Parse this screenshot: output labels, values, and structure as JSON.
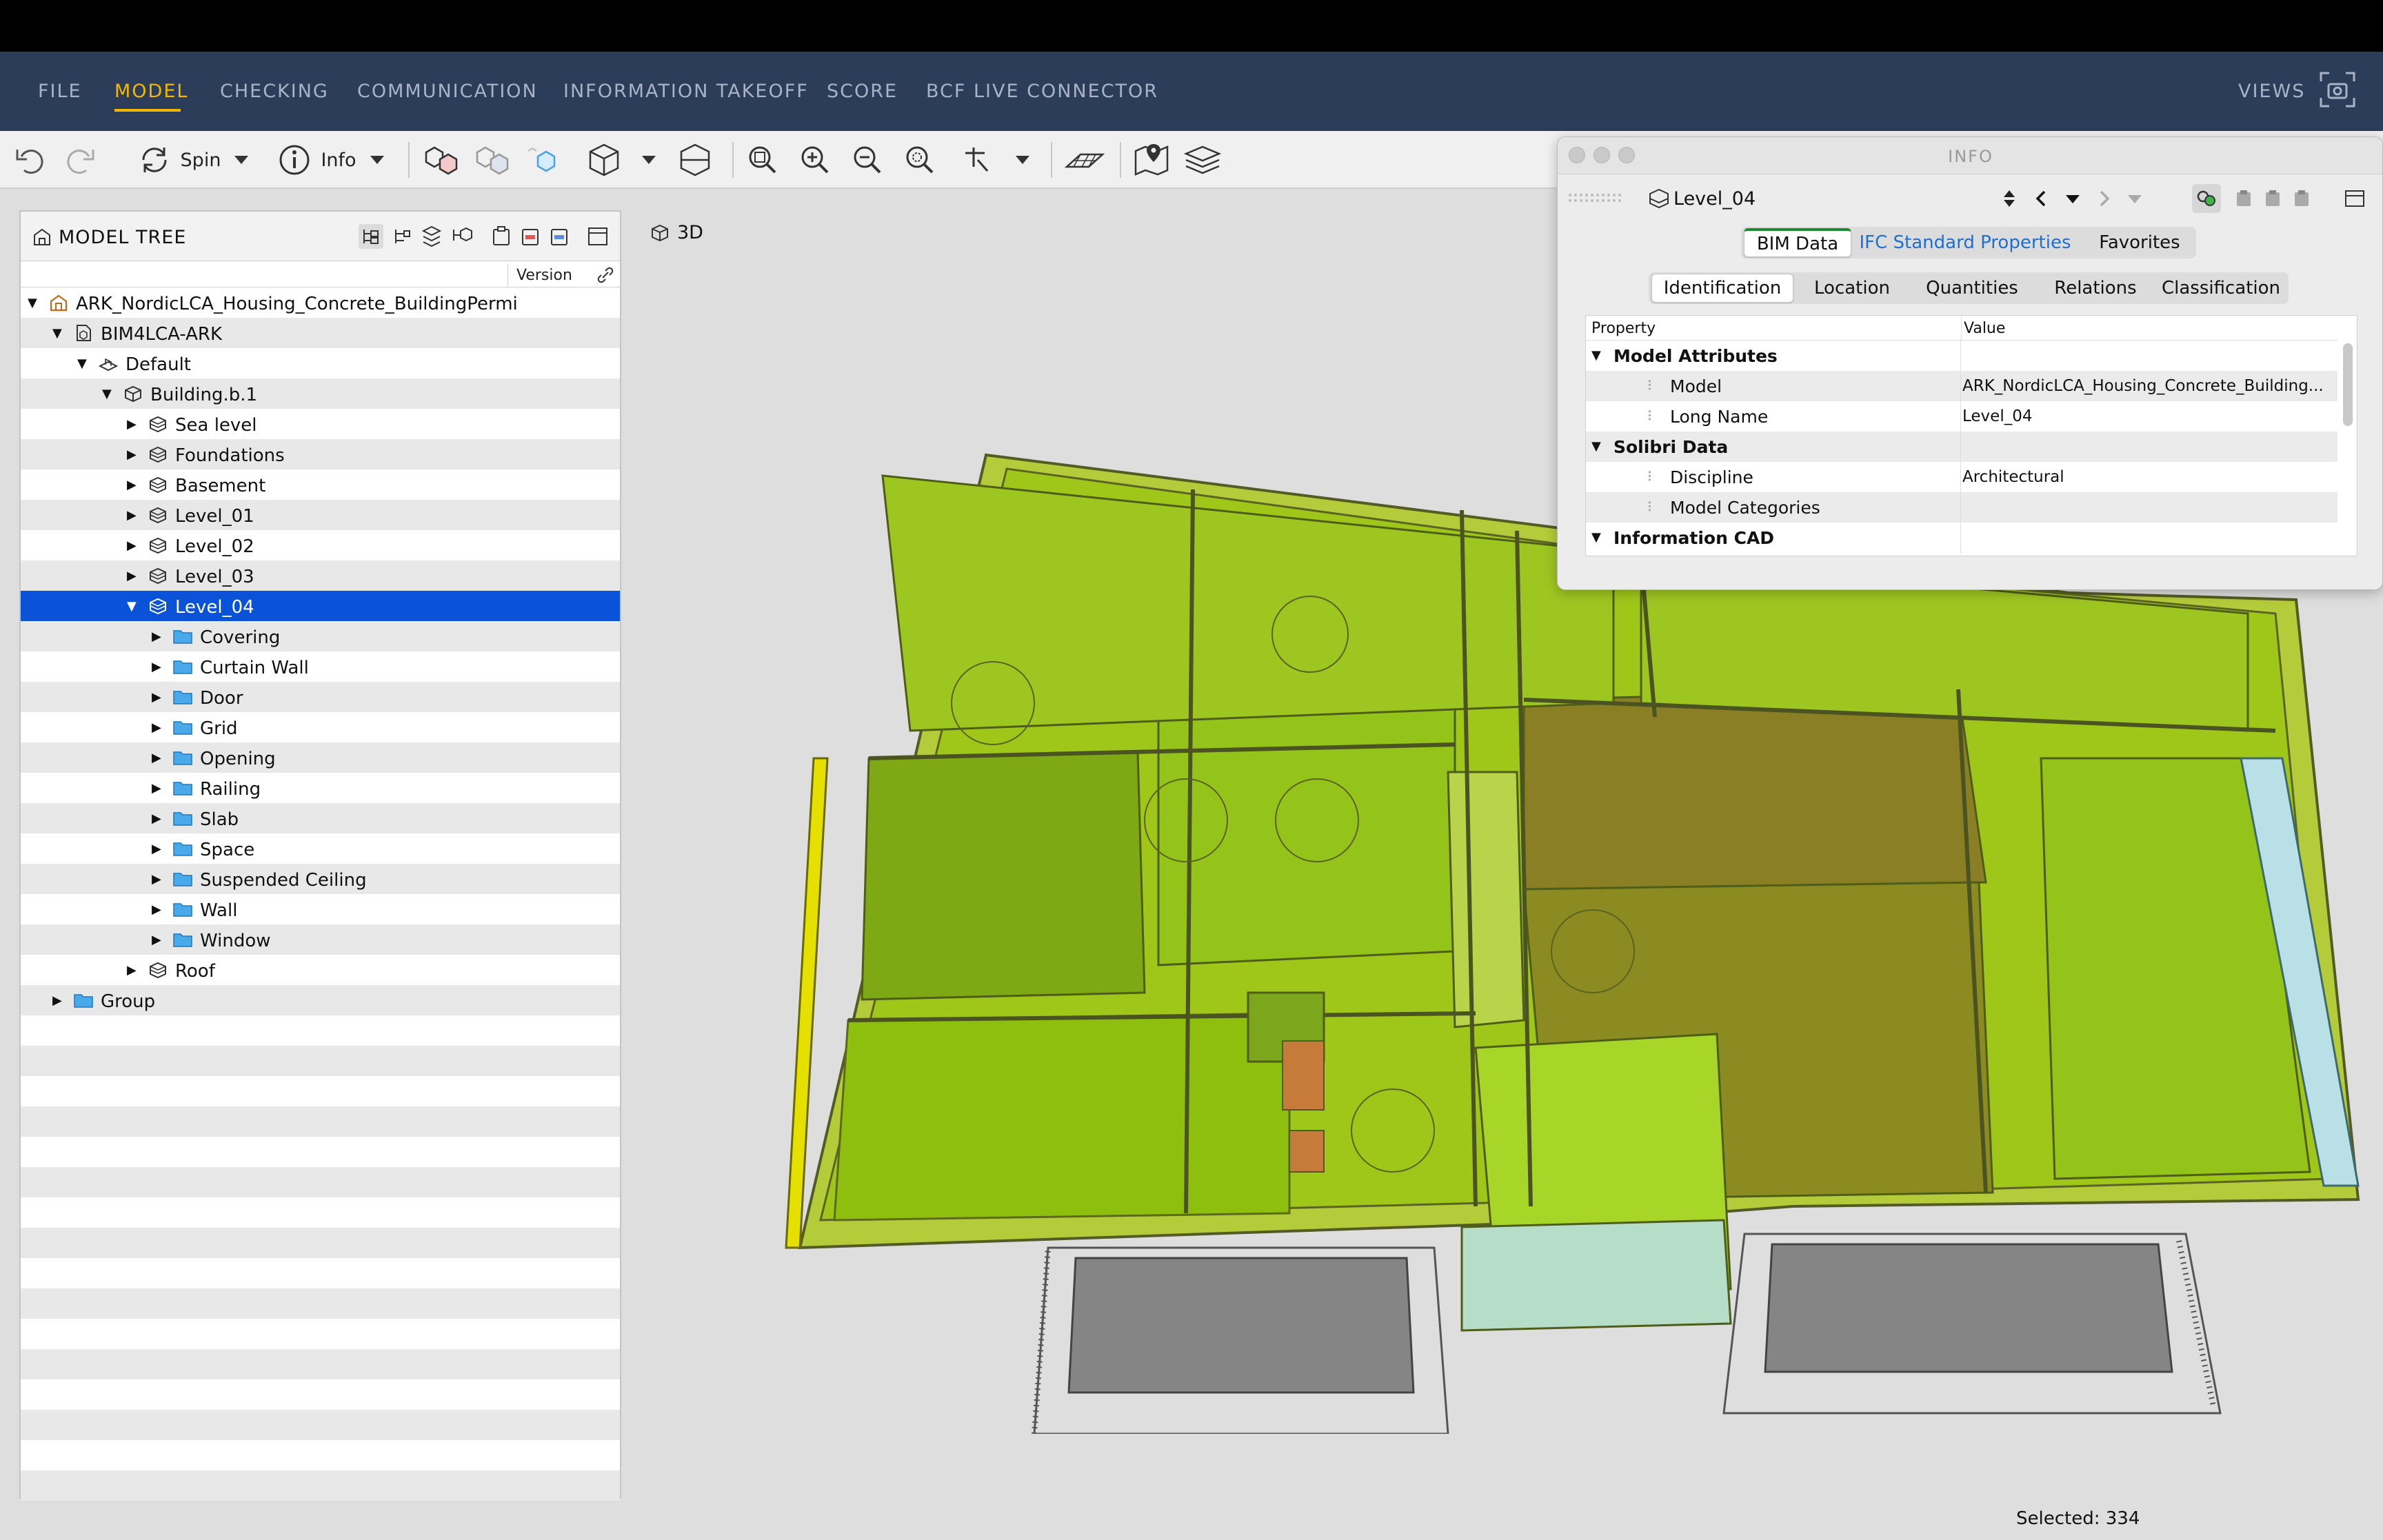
{
  "menubar": {
    "items": [
      "FILE",
      "MODEL",
      "CHECKING",
      "COMMUNICATION",
      "INFORMATION TAKEOFF",
      "SCORE",
      "BCF LIVE CONNECTOR"
    ],
    "active": "MODEL",
    "views_label": "VIEWS"
  },
  "toolbar": {
    "spin_label": "Spin",
    "info_label": "Info"
  },
  "model_tree": {
    "title": "MODEL TREE",
    "version_col": "Version",
    "rows": [
      {
        "label": "ARK_NordicLCA_Housing_Concrete_BuildingPermi",
        "icon": "project-icon",
        "expanded": true
      },
      {
        "label": "BIM4LCA-ARK",
        "icon": "model-file-icon",
        "expanded": true
      },
      {
        "label": "Default",
        "icon": "site-icon",
        "expanded": true
      },
      {
        "label": "Building.b.1",
        "icon": "building-icon",
        "expanded": true
      },
      {
        "label": "Sea level",
        "icon": "storey-icon",
        "expanded": false
      },
      {
        "label": "Foundations",
        "icon": "storey-icon",
        "expanded": false
      },
      {
        "label": "Basement",
        "icon": "storey-icon",
        "expanded": false
      },
      {
        "label": "Level_01",
        "icon": "storey-icon",
        "expanded": false
      },
      {
        "label": "Level_02",
        "icon": "storey-icon",
        "expanded": false
      },
      {
        "label": "Level_03",
        "icon": "storey-icon",
        "expanded": false
      },
      {
        "label": "Level_04",
        "icon": "storey-icon",
        "expanded": true
      },
      {
        "label": "Covering",
        "icon": "folder-icon",
        "expanded": false
      },
      {
        "label": "Curtain Wall",
        "icon": "folder-icon",
        "expanded": false
      },
      {
        "label": "Door",
        "icon": "folder-icon",
        "expanded": false
      },
      {
        "label": "Grid",
        "icon": "folder-icon",
        "expanded": false
      },
      {
        "label": "Opening",
        "icon": "folder-icon",
        "expanded": false
      },
      {
        "label": "Railing",
        "icon": "folder-icon",
        "expanded": false
      },
      {
        "label": "Slab",
        "icon": "folder-icon",
        "expanded": false
      },
      {
        "label": "Space",
        "icon": "folder-icon",
        "expanded": false
      },
      {
        "label": "Suspended Ceiling",
        "icon": "folder-icon",
        "expanded": false
      },
      {
        "label": "Wall",
        "icon": "folder-icon",
        "expanded": false
      },
      {
        "label": "Window",
        "icon": "folder-icon",
        "expanded": false
      },
      {
        "label": "Roof",
        "icon": "storey-icon",
        "expanded": false
      },
      {
        "label": "Group",
        "icon": "folder-icon",
        "expanded": false
      }
    ],
    "selected": "Level_04"
  },
  "viewport": {
    "tab_label": "3D",
    "status": "Selected: 334"
  },
  "info_panel": {
    "title": "INFO",
    "current": "Level_04",
    "tabs": [
      "BIM Data",
      "IFC Standard Properties",
      "Favorites"
    ],
    "active_tab": "BIM Data",
    "subtabs": [
      "Identification",
      "Location",
      "Quantities",
      "Relations",
      "Classification"
    ],
    "active_subtab": "Identification",
    "col_property": "Property",
    "col_value": "Value",
    "rows": [
      {
        "kind": "group",
        "label": "Model Attributes",
        "value": ""
      },
      {
        "kind": "prop",
        "label": "Model",
        "value": "ARK_NordicLCA_Housing_Concrete_Building..."
      },
      {
        "kind": "prop",
        "label": "Long Name",
        "value": "Level_04"
      },
      {
        "kind": "group",
        "label": "Solibri Data",
        "value": ""
      },
      {
        "kind": "prop",
        "label": "Discipline",
        "value": "Architectural"
      },
      {
        "kind": "prop",
        "label": "Model Categories",
        "value": ""
      },
      {
        "kind": "group",
        "label": "Information CAD",
        "value": ""
      }
    ]
  },
  "colors": {
    "menubar_bg": "#2c3d5a",
    "menu_active": "#f2b800",
    "selection": "#0a52d8",
    "model_green": "#a8d400",
    "link_blue": "#1f6fd0"
  }
}
